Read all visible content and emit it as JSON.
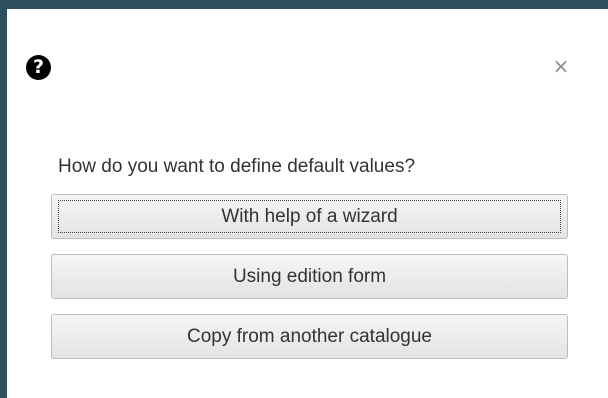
{
  "dialog": {
    "help_icon_glyph": "?",
    "close_icon_glyph": "×",
    "prompt": "How do you want to define default values?",
    "buttons": {
      "wizard": "With help of a wizard",
      "edition_form": "Using edition form",
      "copy": "Copy from another catalogue"
    },
    "focused_button": "wizard"
  },
  "colors": {
    "backdrop": "#2c5060",
    "dialog_background": "#ffffff",
    "button_border": "#bdbdbd",
    "text": "#333333"
  },
  "icons": {
    "help": "question-circle-icon",
    "close": "close-icon"
  }
}
